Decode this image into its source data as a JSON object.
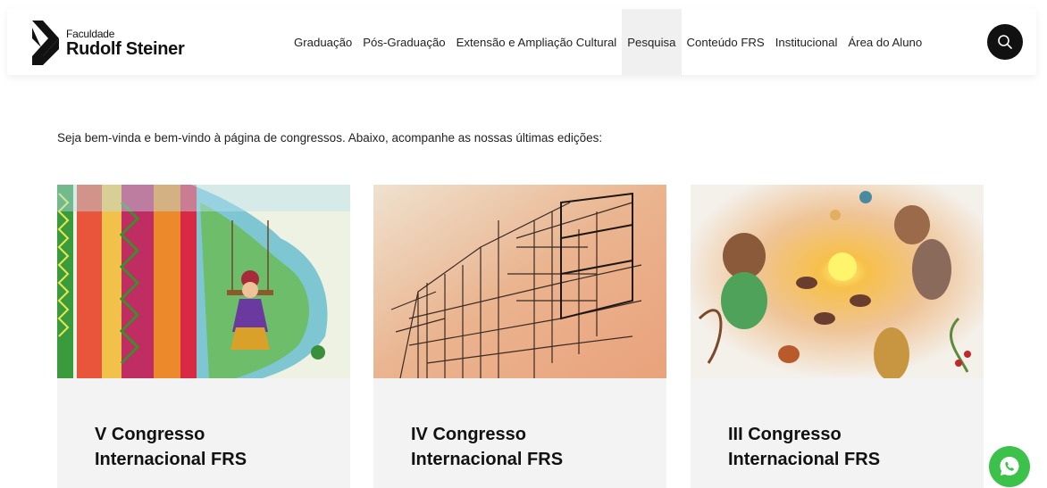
{
  "brand": {
    "small": "Faculdade",
    "big": "Rudolf Steiner",
    "logo_icon": "frs-logo-icon"
  },
  "nav": {
    "items": [
      {
        "label": "Graduação"
      },
      {
        "label": "Pós-Graduação"
      },
      {
        "label": "Extensão e Ampliação Cultural"
      },
      {
        "label": "Pesquisa",
        "active": true
      },
      {
        "label": "Conteúdo FRS"
      },
      {
        "label": "Institucional"
      },
      {
        "label": "Área do Aluno"
      }
    ],
    "search_icon": "search-icon"
  },
  "intro": "Seja bem-vinda e bem-vindo à página de congressos. Abaixo, acompanhe as nossas últimas edições:",
  "cards": [
    {
      "line1": "V Congresso",
      "line2": "Internacional FRS",
      "image_icon": "painting-girl-on-swing"
    },
    {
      "line1": "IV Congresso",
      "line2": "Internacional FRS",
      "image_icon": "sketch-building-scaffold"
    },
    {
      "line1": "III Congresso",
      "line2": "Internacional FRS",
      "image_icon": "painting-people-animals-sun"
    }
  ],
  "whatsapp_icon": "whatsapp-icon",
  "colors": {
    "header_active_bg": "#f0f0f0",
    "card_bg": "#f3f3f3",
    "search_bg": "#111111",
    "whatsapp_green": "#3cc24a"
  }
}
